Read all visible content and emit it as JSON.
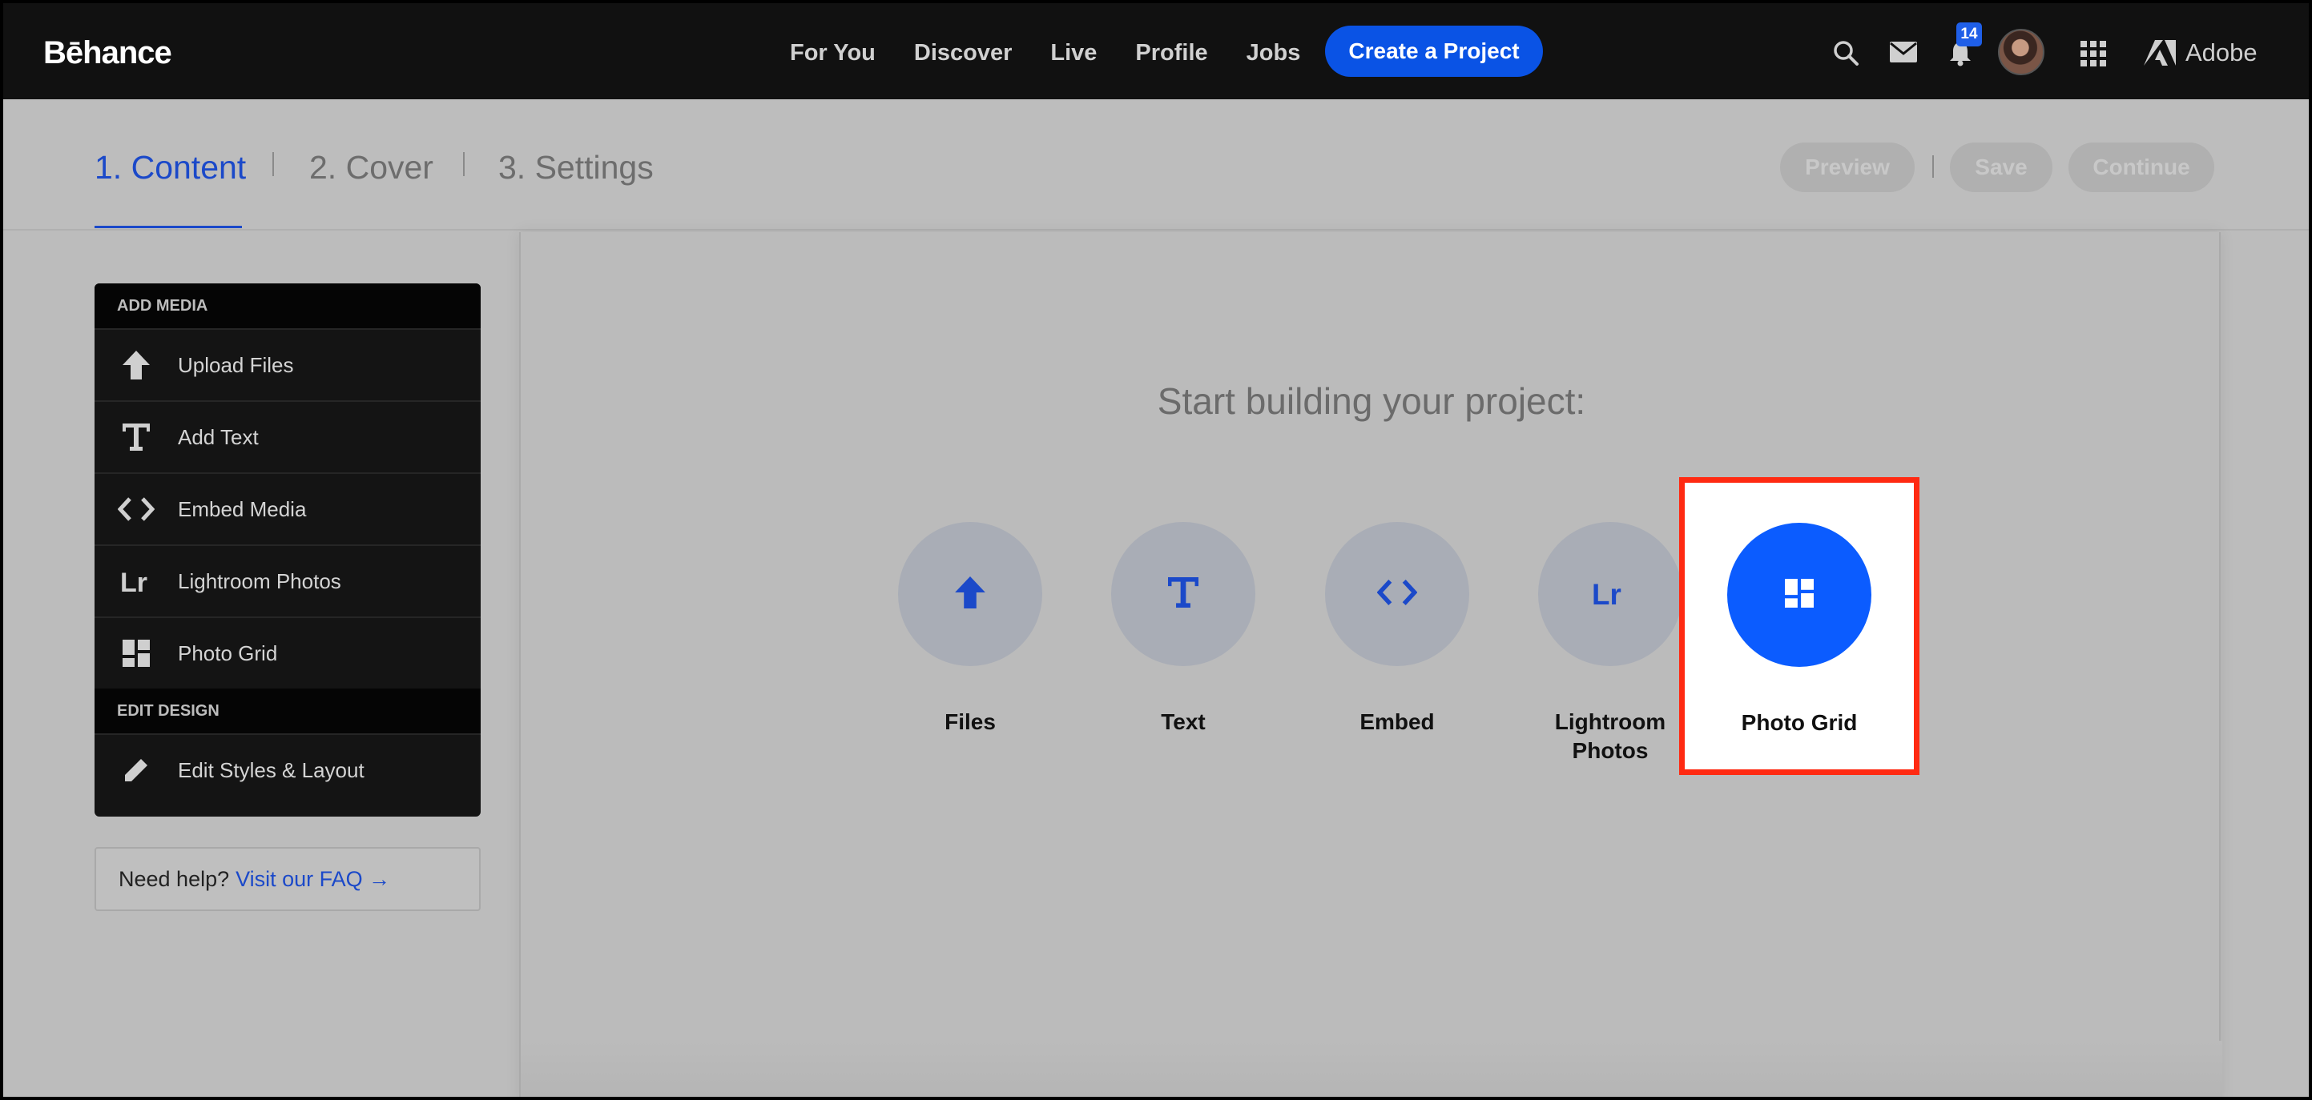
{
  "topnav": {
    "logo": "Bēhance",
    "links": [
      "For You",
      "Discover",
      "Live",
      "Profile",
      "Jobs"
    ],
    "create_label": "Create a Project",
    "notification_count": "14",
    "adobe_label": "Adobe",
    "icons": [
      "search-icon",
      "mail-icon",
      "bell-icon",
      "apps-grid-icon",
      "adobe-logo-icon"
    ]
  },
  "steps": {
    "items": [
      "1. Content",
      "2. Cover",
      "3. Settings"
    ],
    "active_index": 0,
    "actions": {
      "preview": "Preview",
      "save": "Save",
      "continue": "Continue"
    }
  },
  "sidebar": {
    "add_media_heading": "ADD MEDIA",
    "add_media_items": [
      {
        "label": "Upload Files",
        "icon": "upload-arrow-icon"
      },
      {
        "label": "Add Text",
        "icon": "text-t-icon"
      },
      {
        "label": "Embed Media",
        "icon": "embed-code-icon"
      },
      {
        "label": "Lightroom Photos",
        "icon": "lightroom-icon"
      },
      {
        "label": "Photo Grid",
        "icon": "photo-grid-icon"
      }
    ],
    "edit_design_heading": "EDIT DESIGN",
    "edit_design_items": [
      {
        "label": "Edit Styles & Layout",
        "icon": "pencil-icon"
      }
    ]
  },
  "help": {
    "text": "Need help?",
    "link": "Visit our FAQ →"
  },
  "canvas": {
    "title": "Start building your project:",
    "tiles": [
      {
        "label": "Files",
        "icon": "upload-arrow-icon"
      },
      {
        "label": "Text",
        "icon": "text-t-icon"
      },
      {
        "label": "Embed",
        "icon": "embed-code-icon"
      },
      {
        "label": "Lightroom\nPhotos",
        "icon": "lightroom-icon"
      },
      {
        "label": "Photo Grid",
        "icon": "photo-grid-icon",
        "highlighted": true
      }
    ]
  },
  "colors": {
    "accent": "#0a53e5",
    "highlight_border": "#ff2a12",
    "nav_bg": "#111111",
    "overlay_bg": "#bcbcbc"
  }
}
